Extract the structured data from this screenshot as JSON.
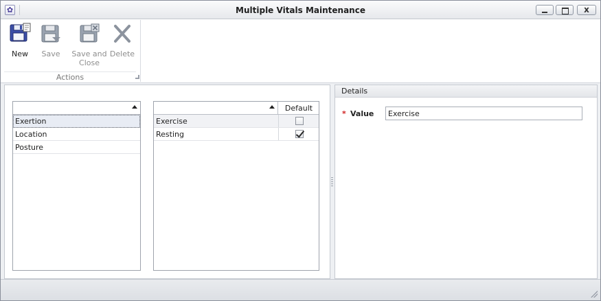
{
  "window": {
    "title": "Multiple Vitals Maintenance",
    "close_glyph": "x"
  },
  "ribbon": {
    "group_label": "Actions",
    "buttons": [
      {
        "label": "New",
        "icon": "save-new-icon",
        "enabled": true
      },
      {
        "label": "Save",
        "icon": "save-icon",
        "enabled": false
      },
      {
        "label": "Save and Close",
        "icon": "save-close-icon",
        "enabled": false
      },
      {
        "label": "Delete",
        "icon": "delete-icon",
        "enabled": false
      }
    ]
  },
  "categories_grid": {
    "rows": [
      "Exertion",
      "Location",
      "Posture"
    ],
    "selected_index": 0
  },
  "values_grid": {
    "default_header": "Default",
    "rows": [
      {
        "value": "Exercise",
        "default": false
      },
      {
        "value": "Resting",
        "default": true
      }
    ]
  },
  "details": {
    "title": "Details",
    "required_marker": "*",
    "value_label": "Value",
    "value": "Exercise"
  },
  "colors": {
    "accent": "#4b3f9a",
    "required": "#d02020",
    "disabled_text": "#8e8e8e"
  }
}
